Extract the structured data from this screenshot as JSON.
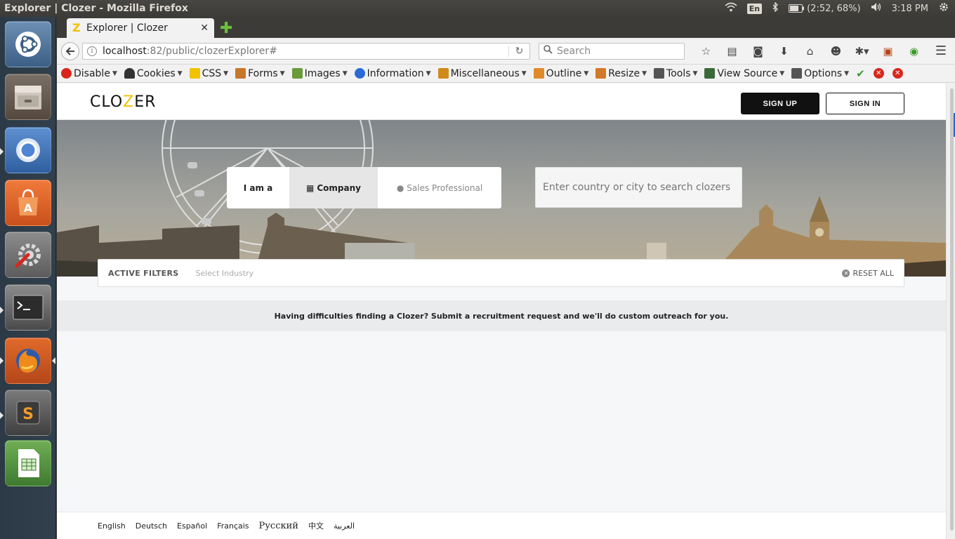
{
  "os": {
    "window_title": "Explorer | Clozer - Mozilla Firefox",
    "keyboard_layout": "En",
    "battery": "(2:52, 68%)",
    "clock": "3:18 PM"
  },
  "launcher": {
    "items": [
      "ubuntu-dash-icon",
      "files-icon",
      "chromium-icon",
      "software-center-icon",
      "system-settings-icon",
      "terminal-icon",
      "firefox-icon",
      "sublime-text-icon",
      "libreoffice-calc-icon"
    ]
  },
  "browser": {
    "tab_title": "Explorer | Clozer",
    "url_host": "localhost",
    "url_path": ":82/public/clozerExplorer#",
    "search_placeholder": "Search",
    "devbar": [
      {
        "label": "Disable",
        "color": "#d9261c"
      },
      {
        "label": "Cookies",
        "color": "#333333"
      },
      {
        "label": "CSS",
        "color": "#f2c200"
      },
      {
        "label": "Forms",
        "color": "#c8762a"
      },
      {
        "label": "Images",
        "color": "#6a9a3a"
      },
      {
        "label": "Information",
        "color": "#2a6ad6"
      },
      {
        "label": "Miscellaneous",
        "color": "#d08a1a"
      },
      {
        "label": "Outline",
        "color": "#e08a2a"
      },
      {
        "label": "Resize",
        "color": "#d07a2a"
      },
      {
        "label": "Tools",
        "color": "#555555"
      },
      {
        "label": "View Source",
        "color": "#3b6a3a"
      },
      {
        "label": "Options",
        "color": "#555555"
      }
    ]
  },
  "site": {
    "logo_pre": "CLO",
    "logo_z": "Z",
    "logo_post": "ER",
    "accent": "#f2c200",
    "signup_label": "SIGN UP",
    "signin_label": "SIGN IN",
    "toggle": {
      "label": "I am a",
      "company": "Company",
      "sales": "Sales Professional"
    },
    "search_placeholder": "Enter country or city to search clozers",
    "filters": {
      "label": "ACTIVE FILTERS",
      "industry_placeholder": "Select Industry",
      "reset": "RESET ALL"
    },
    "notice": "Having difficulties finding a Clozer? Submit a recruitment request and we'll do custom outreach for you.",
    "languages": [
      "English",
      "Deutsch",
      "Español",
      "Français",
      "Русский",
      "中文",
      "العربية"
    ]
  }
}
